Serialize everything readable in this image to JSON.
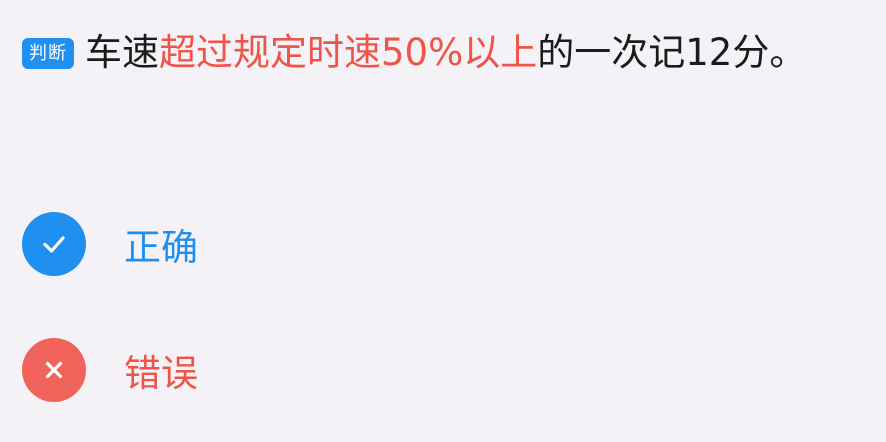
{
  "question": {
    "type_badge": "判断",
    "text_before": "车速",
    "text_highlight": "超过规定时速50%以上",
    "text_after": "的一次记12分。"
  },
  "options": {
    "correct": {
      "label": "正确",
      "icon": "check-icon",
      "color": "#1f8ff0"
    },
    "wrong": {
      "label": "错误",
      "icon": "close-icon",
      "color": "#f0635a"
    }
  },
  "colors": {
    "accent": "#1f8ff0",
    "highlight": "#ee5448",
    "background": "#f4f2f7"
  }
}
